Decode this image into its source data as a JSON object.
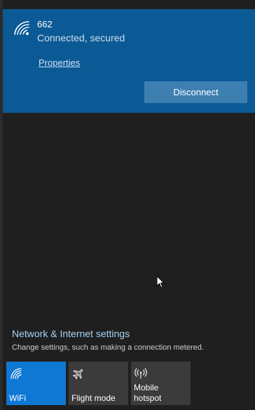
{
  "network": {
    "name": "662",
    "status": "Connected, secured",
    "properties_label": "Properties",
    "disconnect_label": "Disconnect"
  },
  "settings": {
    "link_label": "Network & Internet settings",
    "description": "Change settings, such as making a connection metered."
  },
  "quick_actions": [
    {
      "label": "WiFi",
      "icon": "wifi-icon",
      "active": true
    },
    {
      "label": "Flight mode",
      "icon": "airplane-icon",
      "active": false
    },
    {
      "label": "Mobile hotspot",
      "icon": "hotspot-icon",
      "active": false
    }
  ],
  "colors": {
    "card_background": "#0b5a96",
    "accent": "#0f78d4",
    "link": "#a8d3f5",
    "tile_inactive": "#3b3b3b"
  }
}
